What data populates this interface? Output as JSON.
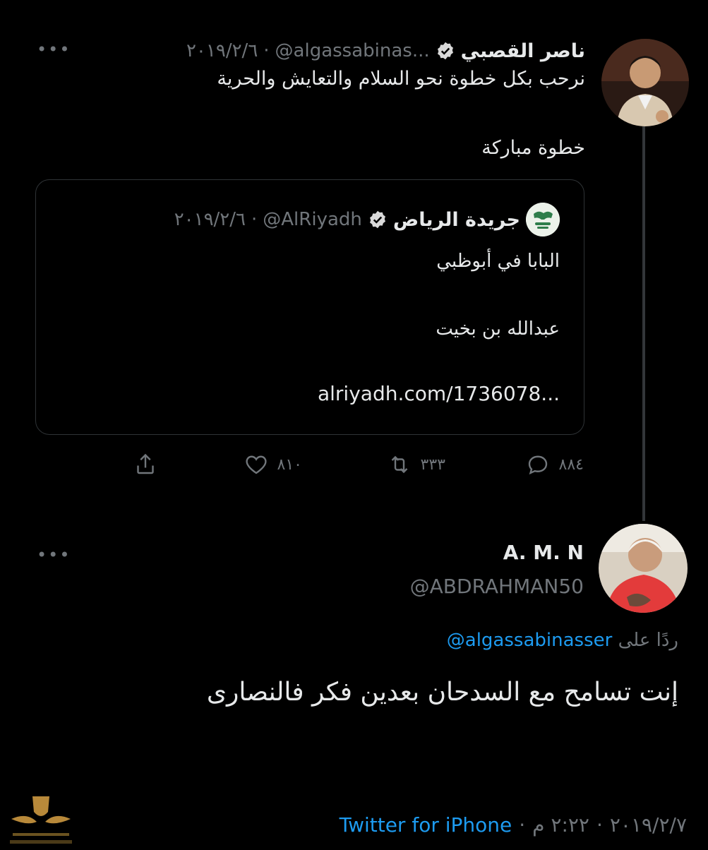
{
  "tweet": {
    "author_name": "ناصر القصبي",
    "handle": "@algassabinas...",
    "date": "٢٠١٩/٢/٦",
    "more_label": "•••",
    "line1": "نرحب بكل خطوة نحو السلام والتعايش والحرية",
    "line2": "خطوة مباركة",
    "quote": {
      "author_name": "جريدة الرياض",
      "handle": "@AlRiyadh",
      "date": "٢٠١٩/٢/٦",
      "line1": "البابا في أبوظبي",
      "line2": "عبدالله بن بخيت",
      "link": "alriyadh.com/1736078..."
    },
    "actions": {
      "replies": "٨٨٤",
      "retweets": "٣٣٣",
      "likes": "٨١٠"
    }
  },
  "reply": {
    "author_name": "A. M. N",
    "handle": "@ABDRAHMAN50",
    "more_label": "•••",
    "replying_to_prefix": "ردًا على",
    "replying_to_handle": "@algassabinasser",
    "text": "إنت تسامح مع السدحان بعدين فكر فالنصارى",
    "date": "٢٠١٩/٢/٧",
    "time": "٢:٢٢ م",
    "source": "Twitter for iPhone"
  },
  "colors": {
    "background": "#000000",
    "text": "#e7e9ea",
    "muted": "#71767b",
    "accent": "#1d9bf0",
    "border": "#2f3336"
  }
}
